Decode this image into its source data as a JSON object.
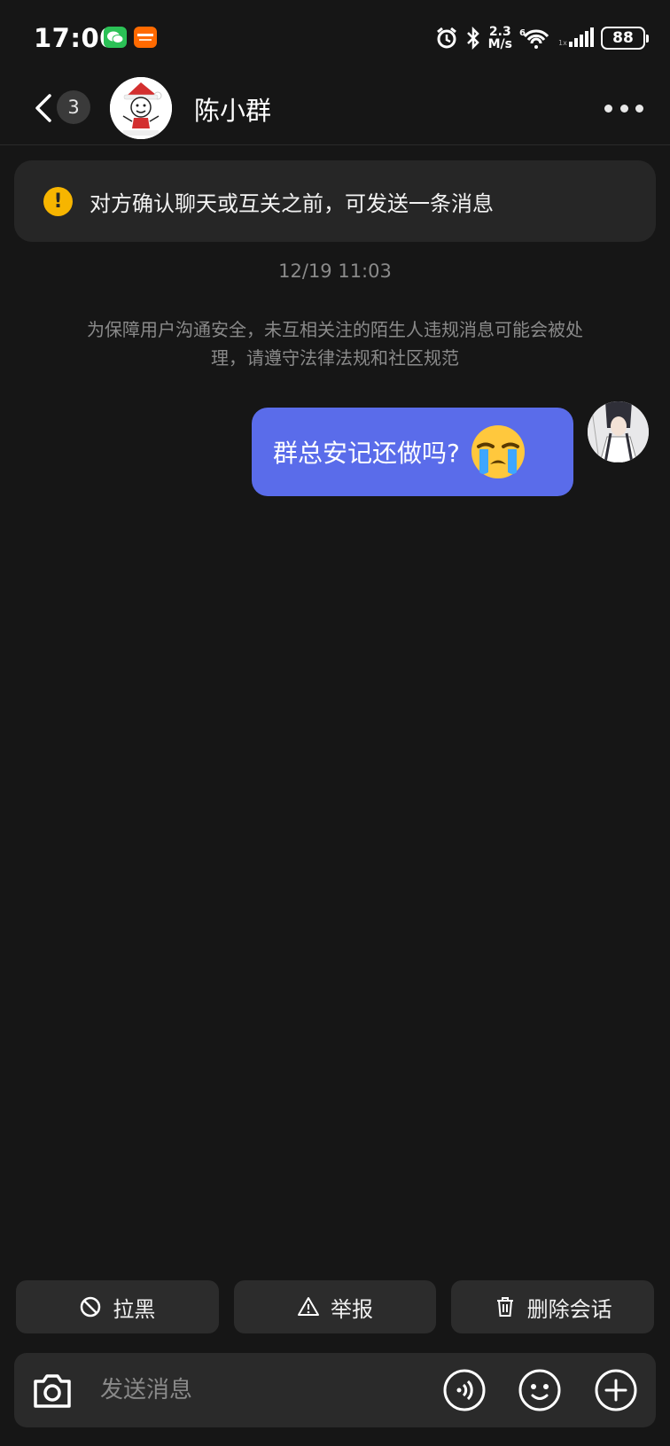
{
  "status_bar": {
    "time": "17:00",
    "net_speed_value": "2.3",
    "net_speed_unit": "M/s",
    "battery": "88",
    "icons": [
      "wechat-icon",
      "taobao-icon",
      "alarm-icon",
      "bluetooth-icon",
      "wifi-icon",
      "signal-icon",
      "battery-icon"
    ]
  },
  "header": {
    "unread_count": "3",
    "contact_name": "陈小群"
  },
  "notice": {
    "text": "对方确认聊天或互关之前，可发送一条消息",
    "icon_color": "#f7b500"
  },
  "chat": {
    "timestamp": "12/19 11:03",
    "safety_tip": "为保障用户沟通安全，未互相关注的陌生人违规消息可能会被处理，请遵守法律法规和社区规范",
    "messages": [
      {
        "from": "self",
        "text": "群总安记还做吗?",
        "emoji": "crying-face",
        "bubble_color": "#5a6cea"
      }
    ]
  },
  "actions": {
    "block_label": "拉黑",
    "report_label": "举报",
    "delete_label": "删除会话"
  },
  "input": {
    "placeholder": "发送消息"
  }
}
